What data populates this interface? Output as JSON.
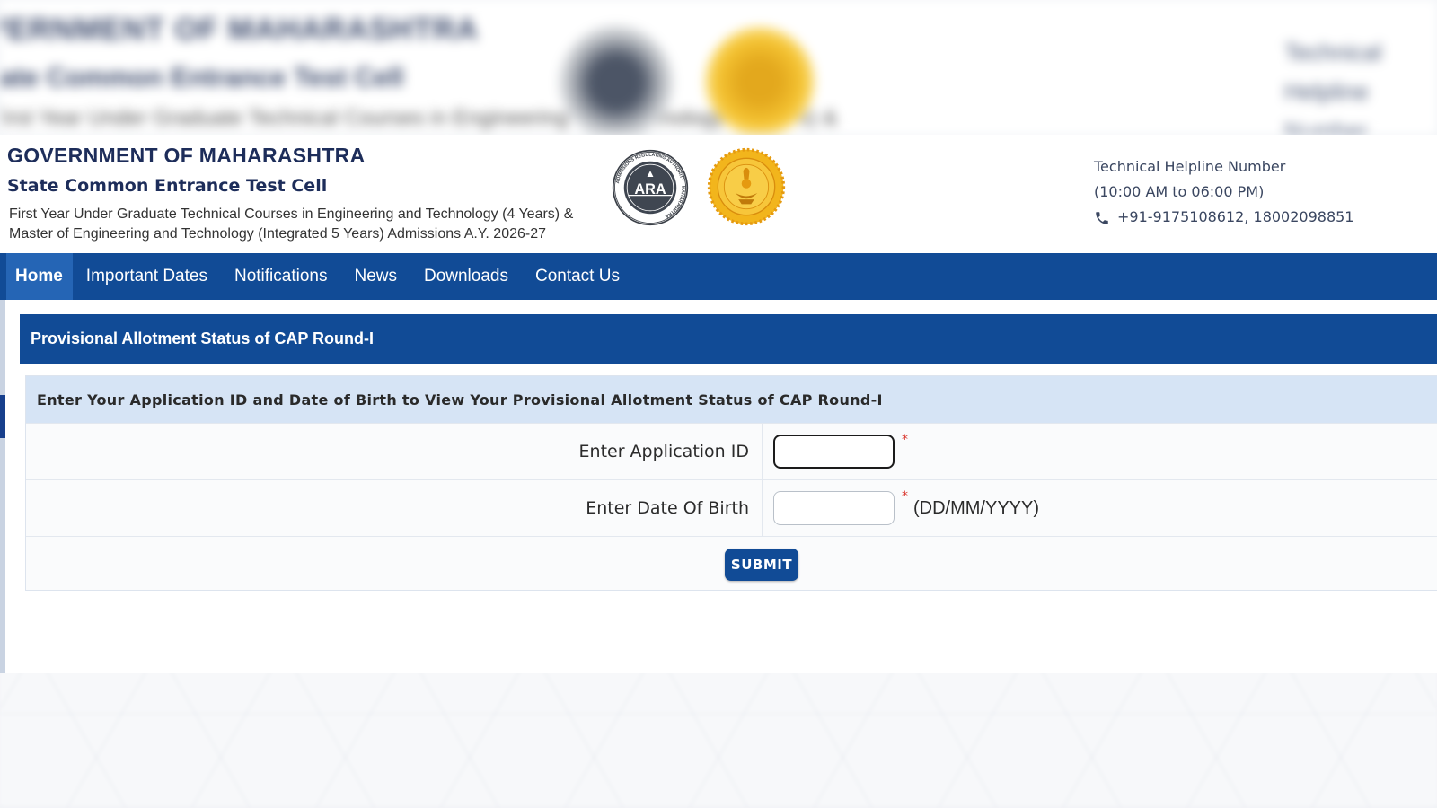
{
  "header": {
    "gov_title": "GOVERNMENT OF MAHARASHTRA",
    "cell_title": "State Common Entrance Test Cell",
    "course_line_1": "First Year Under Graduate Technical Courses in Engineering and Technology (4 Years) &",
    "course_line_2": "Master of Engineering and Technology (Integrated 5 Years) Admissions A.Y. 2026-27",
    "logos": [
      "ara-logo",
      "maharashtra-seal"
    ],
    "ara_logo_text": "ARA",
    "ara_logo_ring_text": "ADMISSIONS REGULATING AUTHORITY · MAHARASHTRA"
  },
  "helpline": {
    "title": "Technical Helpline Number",
    "hours": "(10:00 AM to 06:00 PM)",
    "numbers": "+91-9175108612, 18002098851",
    "icon": "phone-icon"
  },
  "nav": {
    "items": [
      {
        "label": "Home",
        "active": true
      },
      {
        "label": "Important Dates",
        "active": false
      },
      {
        "label": "Notifications",
        "active": false
      },
      {
        "label": "News",
        "active": false
      },
      {
        "label": "Downloads",
        "active": false
      },
      {
        "label": "Contact Us",
        "active": false
      }
    ]
  },
  "panel": {
    "title": "Provisional Allotment Status of CAP Round-I",
    "info": "Enter Your Application ID and Date of Birth to View Your Provisional Allotment Status of CAP Round-I"
  },
  "form": {
    "application_id_label": "Enter Application ID",
    "application_id_value": "",
    "dob_label": "Enter Date Of Birth",
    "dob_value": "",
    "required_mark": "*",
    "dob_format_hint": "(DD/MM/YYYY)",
    "submit_label": "SUBMIT"
  },
  "colors": {
    "nav_bg": "#114b96",
    "nav_active_bg": "#2565b5",
    "info_bg": "#d6e4f5",
    "title_text": "#1d2d5a",
    "required": "#d9342b"
  }
}
